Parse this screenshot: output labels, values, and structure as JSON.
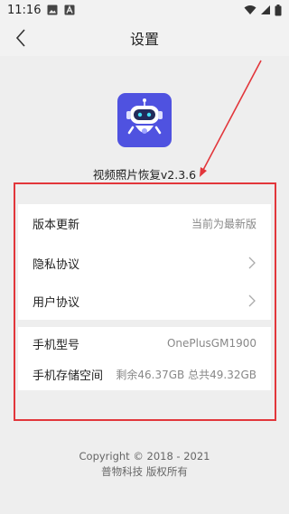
{
  "status_bar": {
    "time": "11:16"
  },
  "header": {
    "title": "设置"
  },
  "app": {
    "name_version": "视频照片恢复v2.3.6"
  },
  "settings": {
    "version_update": {
      "label": "版本更新",
      "value": "当前为最新版"
    },
    "privacy": {
      "label": "隐私协议"
    },
    "user_agreement": {
      "label": "用户协议"
    }
  },
  "device": {
    "model": {
      "label": "手机型号",
      "value": "OnePlusGM1900"
    },
    "storage": {
      "label": "手机存储空间",
      "value": "剩余46.37GB 总共49.32GB"
    }
  },
  "footer": {
    "copyright": "Copyright © 2018 - 2021",
    "company": "普物科技 版权所有"
  },
  "colors": {
    "annotation_red": "#e2363b",
    "app_icon_bg": "#4f52e0"
  },
  "icons": [
    "image-icon",
    "a-icon",
    "wifi-icon",
    "signal-icon",
    "battery-icon",
    "back-icon",
    "robot-icon",
    "chevron-right-icon"
  ]
}
